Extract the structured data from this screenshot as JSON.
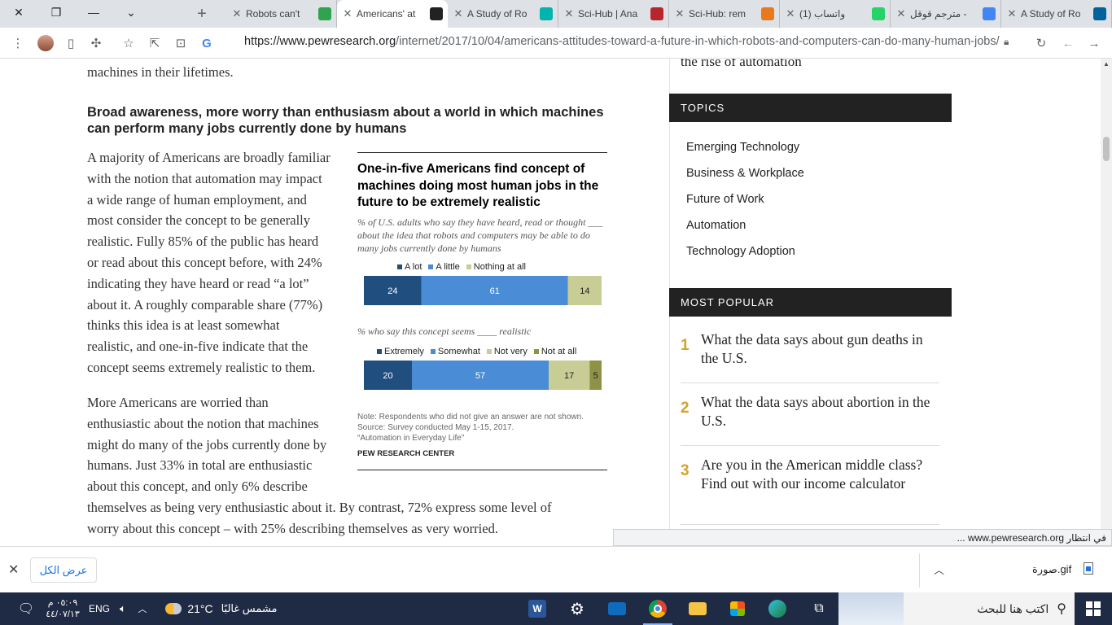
{
  "browser": {
    "tabs": [
      {
        "title": "A Study of Ro",
        "favicon": "IEEE",
        "color": "#00629b"
      },
      {
        "title": "مترجم قوقل -",
        "favicon": "G",
        "color": "#4285f4"
      },
      {
        "title": "(1) واتساب",
        "favicon": "1",
        "color": "#25d366"
      },
      {
        "title": "Sci-Hub: rem",
        "favicon": "eye",
        "color": "#e8791c"
      },
      {
        "title": "Sci-Hub | Ana",
        "favicon": "SCI HUB",
        "color": "#b8262b"
      },
      {
        "title": "A Study of Ro",
        "favicon": "R",
        "color": "#00b5ad"
      },
      {
        "title": "Americans' at",
        "favicon": "pew",
        "color": "#222222"
      },
      {
        "title": "Robots can't",
        "favicon": "e",
        "color": "#2ea44f"
      }
    ],
    "url_host": "https://www.pewresearch.org",
    "url_path": "/internet/2017/10/04/americans-attitudes-toward-a-future-in-which-robots-and-computers-can-do-many-human-jobs/"
  },
  "article": {
    "prev_line": "machines in their lifetimes.",
    "heading": "Broad awareness, more worry than enthusiasm about a world in which machines can perform many jobs currently done by humans",
    "para1": [
      "A majority of Americans are broadly familiar",
      "with the notion that automation may impact",
      "a wide range of human employment, and",
      "most consider the concept to be generally",
      "realistic. Fully 85% of the public has heard",
      "or read about this concept before, with 24%",
      "indicating they have heard or read “a lot”",
      "about it. A roughly comparable share (77%)",
      "thinks this idea is at least somewhat",
      "realistic, and one-in-five indicate that the",
      "concept seems extremely realistic to them."
    ],
    "para2_narrow": [
      "More Americans are worried than",
      "enthusiastic about the notion that machines",
      "might do many of the jobs currently done by",
      "humans. Just 33% in total are enthusiastic",
      "about this concept, and only 6% describe"
    ],
    "para2_wide": [
      "themselves as being very enthusiastic about it. By contrast, 72% express some level of",
      "worry about this concept – with 25% describing themselves as very worried."
    ]
  },
  "chart_data": {
    "type": "bar",
    "orientation": "horizontal-stacked",
    "title": "One-in-five Americans find concept of machines doing most human jobs in the future to be extremely realistic",
    "panels": [
      {
        "subtitle": "% of U.S. adults who say they have heard, read or thought ___ about the idea that robots and computers may be able to do many jobs currently done by humans",
        "series": [
          {
            "name": "A lot",
            "value": 24,
            "color": "#1f4e7f"
          },
          {
            "name": "A little",
            "value": 61,
            "color": "#4a8cd6"
          },
          {
            "name": "Nothing at all",
            "value": 14,
            "color": "#c8cc95"
          }
        ]
      },
      {
        "subtitle": "% who say this concept seems ____ realistic",
        "series": [
          {
            "name": "Extremely",
            "value": 20,
            "color": "#1f4e7f"
          },
          {
            "name": "Somewhat",
            "value": 57,
            "color": "#4a8cd6"
          },
          {
            "name": "Not very",
            "value": 17,
            "color": "#c8cc95"
          },
          {
            "name": "Not at all",
            "value": 5,
            "color": "#8e9247"
          }
        ]
      }
    ],
    "note": [
      "Note: Respondents who did not give an answer are not shown.",
      "Source: Survey conducted May 1-15, 2017.",
      "“Automation in Everyday Life”"
    ],
    "source": "PEW RESEARCH CENTER"
  },
  "sidebar": {
    "top_text": "the rise of automation",
    "topics_head": "TOPICS",
    "topics": [
      "Emerging Technology",
      "Business & Workplace",
      "Future of Work",
      "Automation",
      "Technology Adoption"
    ],
    "popular_head": "MOST POPULAR",
    "popular": [
      {
        "num": "1",
        "title": "What the data says about gun deaths in the U.S."
      },
      {
        "num": "2",
        "title": "What the data says about abortion in the U.S."
      },
      {
        "num": "3",
        "title": "Are you in the American middle class? Find out with our income calculator"
      }
    ]
  },
  "status_bar": "في انتظار www.pewresearch.org ...",
  "downloads": {
    "show_all": "عرض الكل",
    "file": "صورة.gif"
  },
  "taskbar": {
    "search_placeholder": "اكتب هنا للبحث",
    "weather_temp": "21°C",
    "weather_text": "مشمس غالبًا",
    "lang": "ENG",
    "time": "٠٥:٠٩ م",
    "date": "٤٤/٠٧/١٣"
  }
}
